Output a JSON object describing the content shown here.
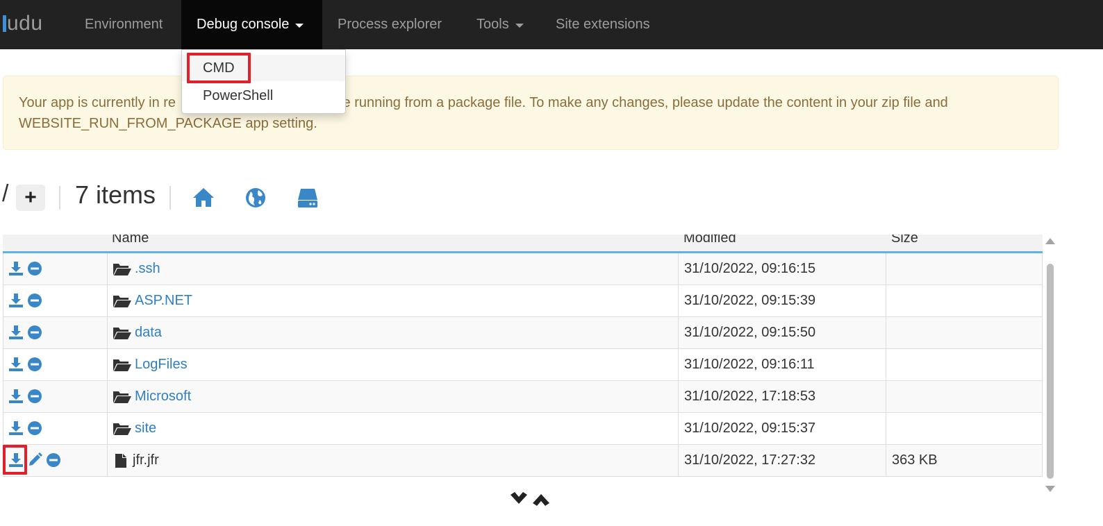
{
  "navbar": {
    "brand": "udu",
    "items": [
      {
        "label": "Environment"
      },
      {
        "label": "Debug console"
      },
      {
        "label": "Process explorer"
      },
      {
        "label": "Tools"
      },
      {
        "label": "Site extensions"
      }
    ]
  },
  "dropdown": {
    "items": [
      {
        "label": "CMD"
      },
      {
        "label": "PowerShell"
      }
    ]
  },
  "alert": {
    "line1": "Your app is currently in re",
    "line1_tail": "u are running from a package file. To make any changes, please update the content in your zip file and",
    "line2": "WEBSITE_RUN_FROM_PACKAGE app setting."
  },
  "pathbar": {
    "root": "/",
    "add_label": "+",
    "count": "7 items",
    "icons": [
      "home-icon",
      "globe-icon",
      "drive-icon"
    ]
  },
  "table": {
    "columns": [
      "Name",
      "Modified",
      "Size"
    ],
    "rows": [
      {
        "name": ".ssh",
        "type": "folder",
        "modified": "31/10/2022, 09:16:15",
        "size": ""
      },
      {
        "name": "ASP.NET",
        "type": "folder",
        "modified": "31/10/2022, 09:15:39",
        "size": ""
      },
      {
        "name": "data",
        "type": "folder",
        "modified": "31/10/2022, 09:15:50",
        "size": ""
      },
      {
        "name": "LogFiles",
        "type": "folder",
        "modified": "31/10/2022, 09:16:11",
        "size": ""
      },
      {
        "name": "Microsoft",
        "type": "folder",
        "modified": "31/10/2022, 17:18:53",
        "size": ""
      },
      {
        "name": "site",
        "type": "folder",
        "modified": "31/10/2022, 09:15:37",
        "size": ""
      },
      {
        "name": "jfr.jfr",
        "type": "file",
        "modified": "31/10/2022, 17:27:32",
        "size": "363 KB"
      }
    ]
  },
  "colors": {
    "navbar_bg": "#222222",
    "link": "#2f7fc4",
    "icon_blue": "#3a87c8",
    "highlight": "#e0202a",
    "alert_bg": "#fcf8e3",
    "alert_text": "#8a6d3b",
    "header_border": "#5bb4e5"
  }
}
